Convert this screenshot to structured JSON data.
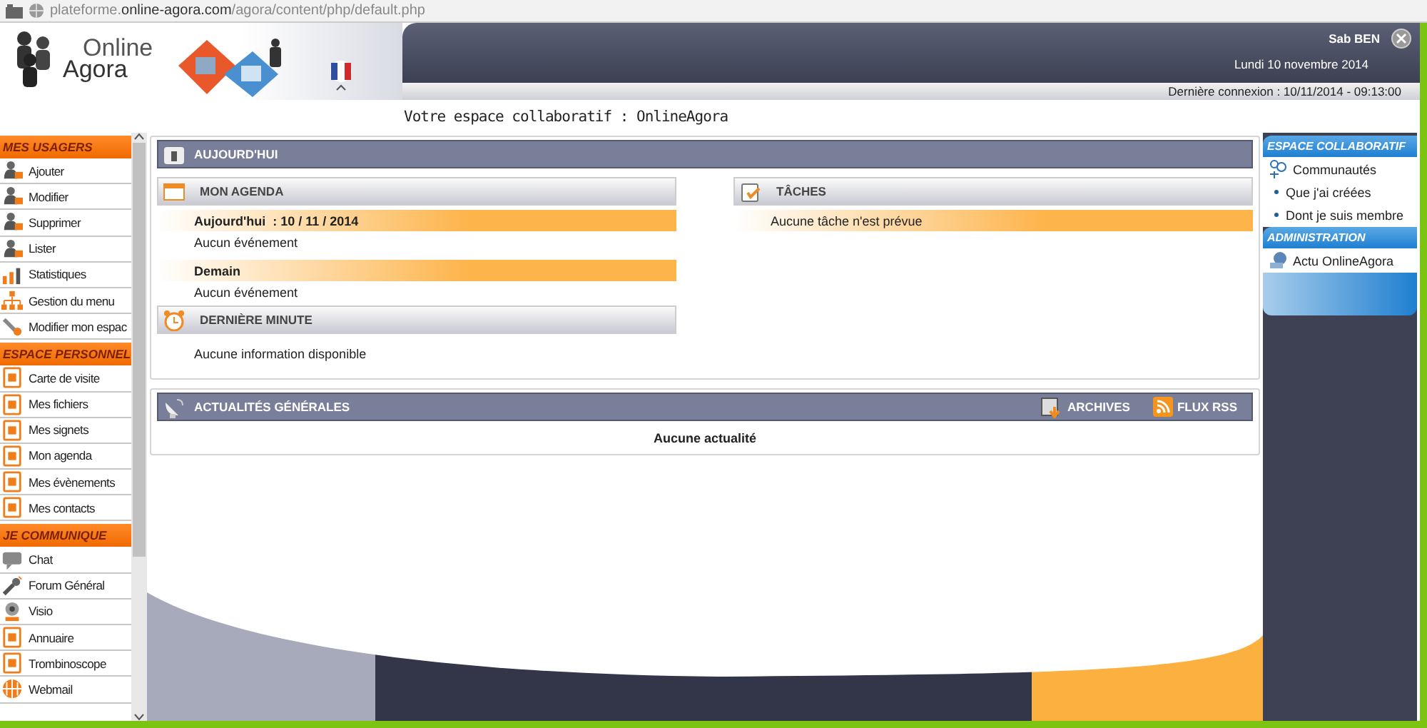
{
  "browser": {
    "url": "plateforme.**online-agora.com**/agora/content/php/default.php"
  },
  "header": {
    "logo": [
      "Online",
      "Agora"
    ],
    "user": "Sab BEN",
    "date": "Lundi 10 novembre 2014",
    "last_login": "Dernière connexion : 10/11/2014 - 09:13:00",
    "page_title": "Votre espace collaboratif : OnlineAgora"
  },
  "sidebar": {
    "sections": [
      {
        "title": "MES USAGERS",
        "items": [
          {
            "label": "Ajouter"
          },
          {
            "label": "Modifier"
          },
          {
            "label": "Supprimer"
          },
          {
            "label": "Lister"
          },
          {
            "label": "Statistiques"
          },
          {
            "label": "Gestion du menu"
          },
          {
            "label": "Modifier mon espac"
          }
        ]
      },
      {
        "title": "ESPACE PERSONNEL",
        "items": [
          {
            "label": "Carte de visite"
          },
          {
            "label": "Mes fichiers"
          },
          {
            "label": "Mes signets"
          },
          {
            "label": "Mon agenda"
          },
          {
            "label": "Mes évènements"
          },
          {
            "label": "Mes contacts"
          }
        ]
      },
      {
        "title": "JE COMMUNIQUE",
        "items": [
          {
            "label": "Chat"
          },
          {
            "label": "Forum Général"
          },
          {
            "label": "Visio"
          },
          {
            "label": "Annuaire"
          },
          {
            "label": "Trombinoscope"
          },
          {
            "label": "Webmail"
          }
        ]
      }
    ]
  },
  "today": {
    "title": "AUJOURD'HUI",
    "agenda": {
      "title": "MON AGENDA",
      "days": [
        {
          "heading": "Aujourd'hui  : 10 / 11 / 2014",
          "text": "Aucun événement"
        },
        {
          "heading": "Demain",
          "text": "Aucun événement"
        }
      ]
    },
    "last_minute": {
      "title": "DERNIÈRE MINUTE",
      "text": "Aucune information disponible"
    },
    "tasks": {
      "title": "TÂCHES",
      "text": "Aucune tâche n'est prévue"
    }
  },
  "news": {
    "title": "ACTUALITÉS GÉNÉRALES",
    "actions": [
      "ARCHIVES",
      "FLUX RSS"
    ],
    "text": "Aucune actualité"
  },
  "right_panel": {
    "sections": [
      {
        "title": "ESPACE COLLABORATIF",
        "items": [
          {
            "label": "Communautés",
            "children": [
              {
                "label": "Que j'ai créées"
              },
              {
                "label": "Dont je suis membre"
              }
            ]
          }
        ]
      },
      {
        "title": "ADMINISTRATION",
        "items": [
          {
            "label": "Actu OnlineAgora"
          }
        ]
      }
    ]
  }
}
